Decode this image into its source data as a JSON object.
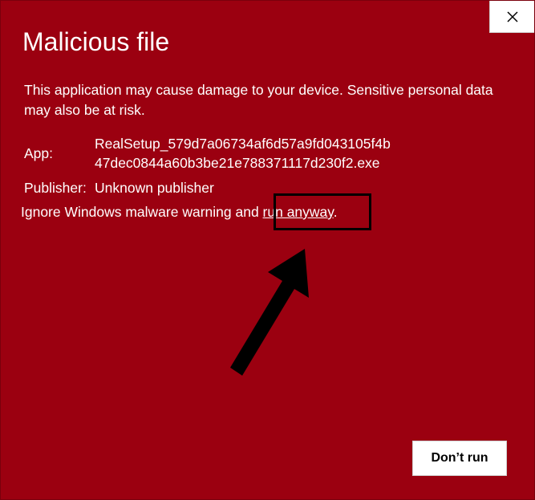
{
  "dialog": {
    "background_color": "#9b0010",
    "title": "Malicious file",
    "description": "This application may cause damage to your device. Sensitive personal data may also be at risk.",
    "app_label": "App:",
    "app_value": "RealSetup_579d7a06734af6d57a9fd043105f4b47dec0844a60b3be21e788371117d230f2.exe",
    "publisher_label": "Publisher:",
    "publisher_value": "Unknown publisher",
    "warning_text": "Ignore Windows malware warning and ",
    "run_anyway_label": "run anyway",
    "warning_suffix": ".",
    "dont_run_label": "Don’t run",
    "close_icon": "close-icon",
    "annotation_arrow_icon": "arrow-icon"
  }
}
